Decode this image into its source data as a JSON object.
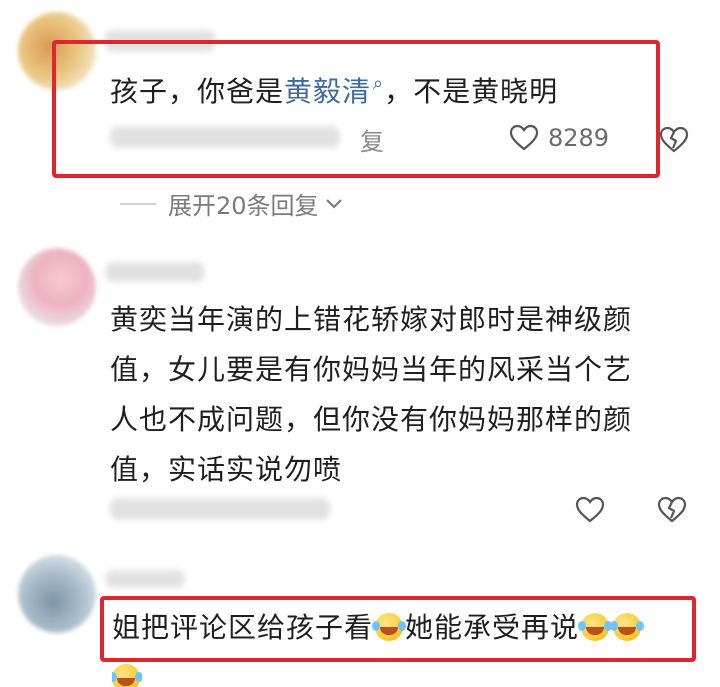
{
  "comments": [
    {
      "text_before": "孩子，你爸是",
      "mention": "黄毅清",
      "text_after": "，不是黄晓明",
      "meta_tail": "复",
      "likes": "8289"
    },
    {
      "lines": [
        "黄奕当年演的上错花轿嫁对郎时是神级颜",
        "值，女儿要是有你妈妈当年的风采当个艺",
        "人也不成问题，但你没有你妈妈那样的颜",
        "值，实话实说勿喷"
      ]
    },
    {
      "part1": "姐把评论区给孩子看",
      "part2": "她能承受再说"
    }
  ],
  "replies": {
    "label": "展开20条回复"
  },
  "icons": {
    "like": "heart-outline-icon",
    "dislike": "broken-heart-icon",
    "mention_search": "search-icon",
    "emoji": "laughing-tears-emoji"
  },
  "colors": {
    "highlight": "#e0262c",
    "link": "#3d6a9e"
  }
}
